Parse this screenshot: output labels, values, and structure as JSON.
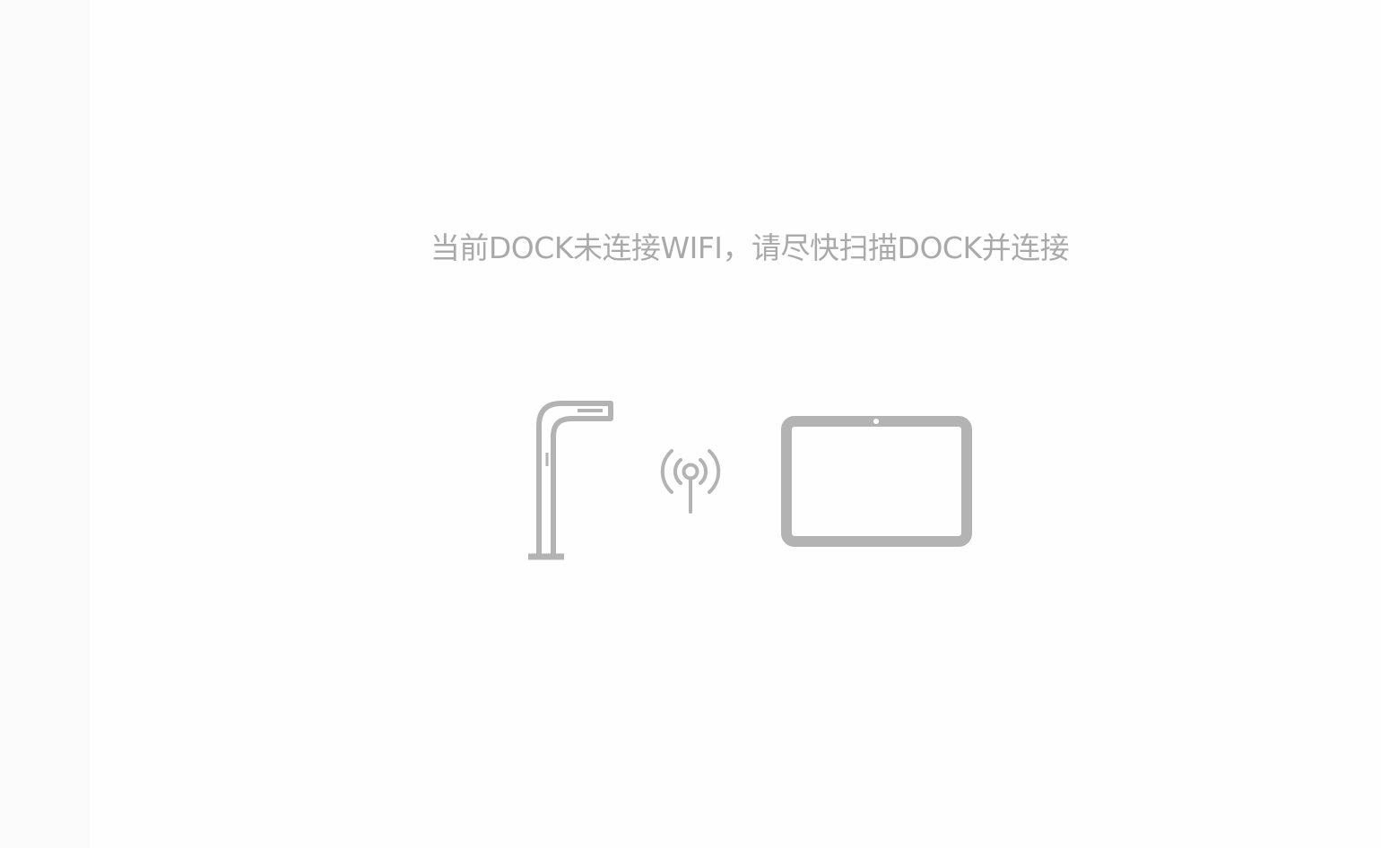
{
  "status": {
    "message": "当前DOCK未连接WIFI，请尽快扫描DOCK并连接"
  },
  "icons": {
    "dock": "dock-stand-icon",
    "signal": "wireless-signal-icon",
    "tablet": "tablet-icon"
  },
  "colors": {
    "text": "#a9a9a9",
    "icon": "#b3b3b3",
    "background": "#fefefe"
  }
}
